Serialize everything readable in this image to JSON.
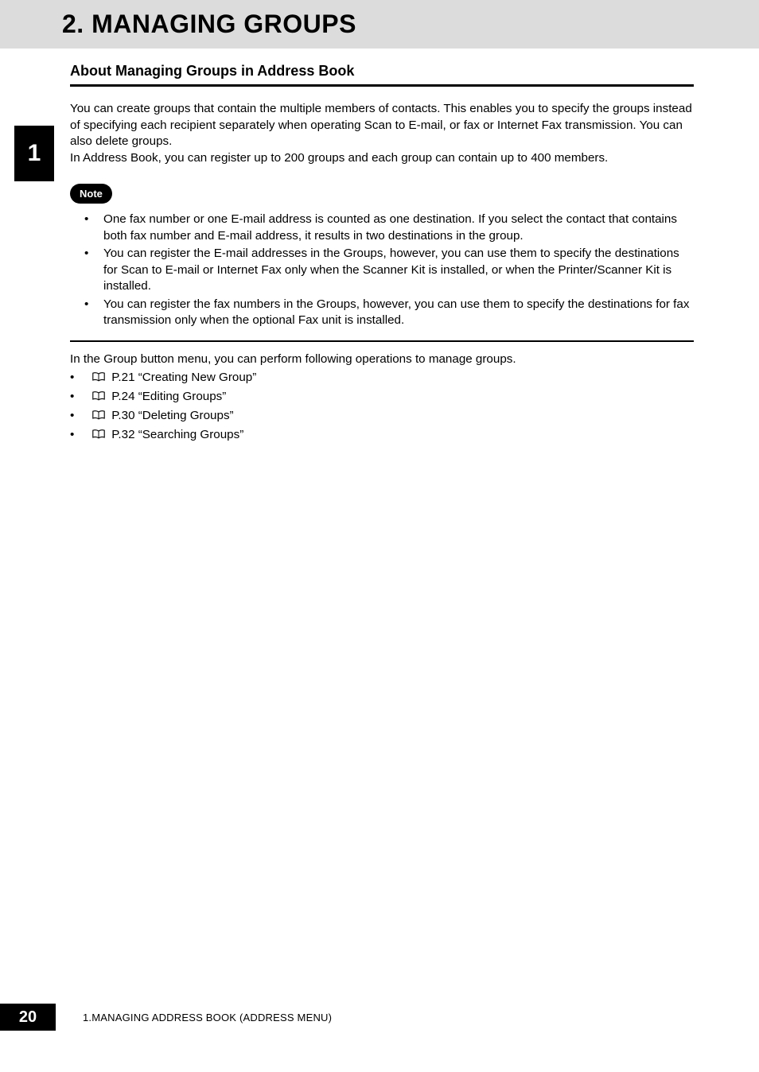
{
  "header": {
    "title": "2. MANAGING GROUPS"
  },
  "chapter_tab": "1",
  "section": {
    "heading": "About Managing Groups in Address Book",
    "intro_para": "You can create groups that contain the multiple members of contacts. This enables you to specify the groups instead of specifying each recipient separately when operating Scan to E-mail, or fax or Internet Fax transmission. You can also delete groups.\nIn Address Book, you can register up to 200 groups and each group can contain up to 400 members.",
    "note_label": "Note",
    "notes": [
      "One fax number or one E-mail address is counted as one destination.  If you select the contact that contains both fax number and E-mail address, it results in two destinations in the group.",
      "You can register the E-mail addresses in the Groups, however, you can use them to specify the destinations for Scan to E-mail or Internet Fax only when the Scanner Kit is installed, or when the Printer/Scanner Kit is installed.",
      "You can register the fax numbers in the Groups, however, you can use them to specify the destinations for fax transmission only when the optional Fax unit is installed."
    ],
    "ops_lead": "In the Group button menu, you can perform following operations to manage groups.",
    "refs": [
      "P.21 “Creating New Group”",
      "P.24 “Editing Groups”",
      "P.30 “Deleting Groups”",
      "P.32 “Searching Groups”"
    ]
  },
  "footer": {
    "page_number": "20",
    "chapter_label": "1.MANAGING ADDRESS BOOK (ADDRESS MENU)"
  }
}
